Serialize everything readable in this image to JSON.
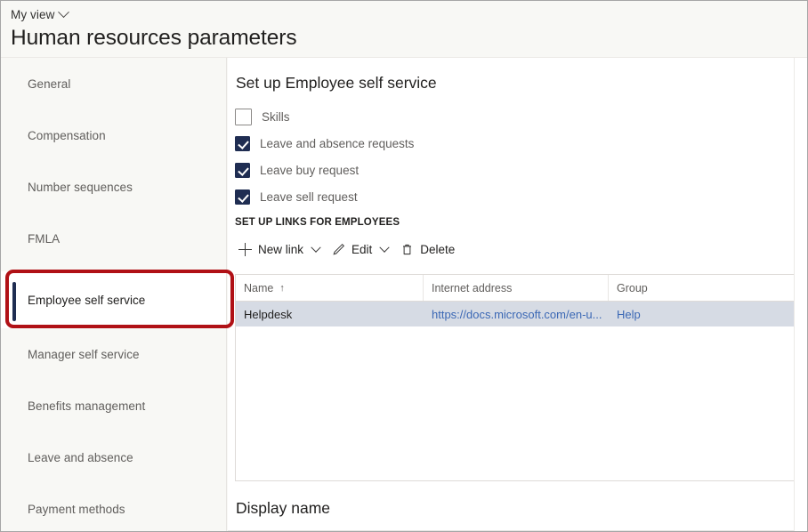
{
  "header": {
    "view_selector_label": "My view",
    "view_selector_icon": "chevron-down-icon",
    "refresh_arc_icon": "circular-arc-icon",
    "title": "Human resources parameters"
  },
  "sidebar": {
    "items": [
      {
        "label": "General",
        "selected": false
      },
      {
        "label": "Compensation",
        "selected": false
      },
      {
        "label": "Number sequences",
        "selected": false
      },
      {
        "label": "FMLA",
        "selected": false
      },
      {
        "label": "Employee self service",
        "selected": true
      },
      {
        "label": "Manager self service",
        "selected": false
      },
      {
        "label": "Benefits management",
        "selected": false
      },
      {
        "label": "Leave and absence",
        "selected": false
      },
      {
        "label": "Payment methods",
        "selected": false
      }
    ]
  },
  "annotation": {
    "color": "#b01116",
    "target": "Employee self service"
  },
  "main": {
    "section_title": "Set up Employee self service",
    "checkboxes": [
      {
        "label": "Skills",
        "checked": false
      },
      {
        "label": "Leave and absence requests",
        "checked": true
      },
      {
        "label": "Leave buy request",
        "checked": true
      },
      {
        "label": "Leave sell request",
        "checked": true
      }
    ],
    "group_label": "SET UP LINKS FOR EMPLOYEES",
    "toolbar": [
      {
        "label": "New link",
        "icon": "plus-icon",
        "has_chevron": true
      },
      {
        "label": "Edit",
        "icon": "pencil-icon",
        "has_chevron": true
      },
      {
        "label": "Delete",
        "icon": "trash-icon",
        "has_chevron": false
      }
    ],
    "grid": {
      "columns": [
        "Name",
        "Internet address",
        "Group"
      ],
      "sort_column": "Name",
      "sort_indicator": "↑",
      "rows": [
        {
          "name": "Helpdesk",
          "internet_address": "https://docs.microsoft.com/en-u...",
          "group": "Help",
          "selected": true
        }
      ]
    },
    "footer_section_title": "Display name"
  },
  "colors": {
    "accent_navy": "#1f2d52",
    "link_blue": "#3b68b5",
    "row_selected": "#d6dbe4",
    "sidebar_bg": "#f8f8f5",
    "annotation_red": "#b01116"
  }
}
